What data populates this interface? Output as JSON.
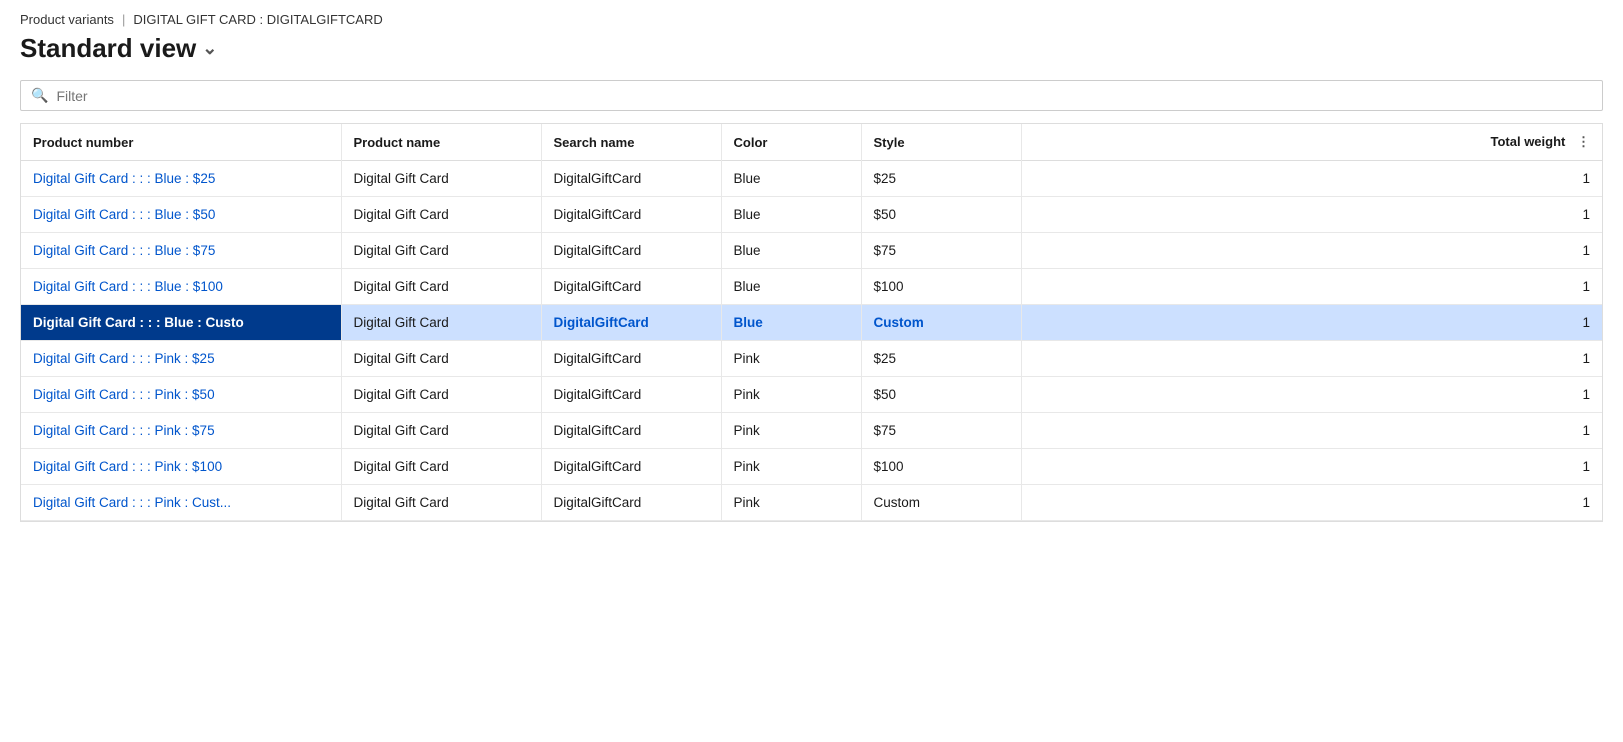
{
  "breadcrumb": {
    "parent": "Product variants",
    "separator": "|",
    "current": "DIGITAL GIFT CARD : DIGITALGIFTCARD"
  },
  "view_title": "Standard view",
  "filter": {
    "placeholder": "Filter"
  },
  "columns": [
    {
      "key": "product_number",
      "label": "Product number"
    },
    {
      "key": "product_name",
      "label": "Product name"
    },
    {
      "key": "search_name",
      "label": "Search name"
    },
    {
      "key": "color",
      "label": "Color"
    },
    {
      "key": "style",
      "label": "Style"
    },
    {
      "key": "total_weight",
      "label": "Total weight"
    }
  ],
  "rows": [
    {
      "product_number": "Digital Gift Card : : : Blue : $25",
      "product_name": "Digital Gift Card",
      "search_name": "DigitalGiftCard",
      "color": "Blue",
      "style": "$25",
      "total_weight": "1",
      "selected": false
    },
    {
      "product_number": "Digital Gift Card : : : Blue : $50",
      "product_name": "Digital Gift Card",
      "search_name": "DigitalGiftCard",
      "color": "Blue",
      "style": "$50",
      "total_weight": "1",
      "selected": false
    },
    {
      "product_number": "Digital Gift Card : : : Blue : $75",
      "product_name": "Digital Gift Card",
      "search_name": "DigitalGiftCard",
      "color": "Blue",
      "style": "$75",
      "total_weight": "1",
      "selected": false
    },
    {
      "product_number": "Digital Gift Card : : : Blue : $100",
      "product_name": "Digital Gift Card",
      "search_name": "DigitalGiftCard",
      "color": "Blue",
      "style": "$100",
      "total_weight": "1",
      "selected": false
    },
    {
      "product_number": "Digital Gift Card : : : Blue : Custo",
      "product_name": "Digital Gift Card",
      "search_name": "DigitalGiftCard",
      "color": "Blue",
      "style": "Custom",
      "total_weight": "1",
      "selected": true
    },
    {
      "product_number": "Digital Gift Card : : : Pink : $25",
      "product_name": "Digital Gift Card",
      "search_name": "DigitalGiftCard",
      "color": "Pink",
      "style": "$25",
      "total_weight": "1",
      "selected": false
    },
    {
      "product_number": "Digital Gift Card : : : Pink : $50",
      "product_name": "Digital Gift Card",
      "search_name": "DigitalGiftCard",
      "color": "Pink",
      "style": "$50",
      "total_weight": "1",
      "selected": false
    },
    {
      "product_number": "Digital Gift Card : : : Pink : $75",
      "product_name": "Digital Gift Card",
      "search_name": "DigitalGiftCard",
      "color": "Pink",
      "style": "$75",
      "total_weight": "1",
      "selected": false
    },
    {
      "product_number": "Digital Gift Card : : : Pink : $100",
      "product_name": "Digital Gift Card",
      "search_name": "DigitalGiftCard",
      "color": "Pink",
      "style": "$100",
      "total_weight": "1",
      "selected": false
    },
    {
      "product_number": "Digital Gift Card : : : Pink : Cust...",
      "product_name": "Digital Gift Card",
      "search_name": "DigitalGiftCard",
      "color": "Pink",
      "style": "Custom",
      "total_weight": "1",
      "selected": false
    }
  ]
}
